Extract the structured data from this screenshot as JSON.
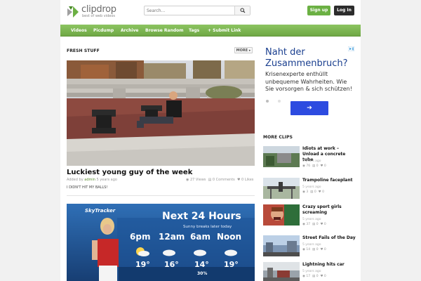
{
  "brand": {
    "name": "clipdrop",
    "tagline": "best of web videos"
  },
  "search": {
    "placeholder": "Search..."
  },
  "auth": {
    "signup": "Sign up",
    "login": "Log In"
  },
  "nav": {
    "items": [
      {
        "label": "Videos"
      },
      {
        "label": "Picdump"
      },
      {
        "label": "Archive"
      },
      {
        "label": "Browse Random"
      },
      {
        "label": "Tags"
      },
      {
        "label": "+ Submit Link"
      }
    ]
  },
  "fresh": {
    "title": "FRESH STUFF",
    "more": "MORE ▸",
    "post": {
      "title": "Luckiest young guy of the week",
      "added_by": "Added by",
      "author": "admin",
      "age": "5 years ago",
      "views": "27 Views",
      "comments": "0 Comments",
      "likes": "0 Likes",
      "excerpt": "I DIDN'T HIT MY BALLS!"
    },
    "weather": {
      "brand": "SkyTracker",
      "headline": "Next 24 Hours",
      "sub": "Sunny breaks later today",
      "times": [
        "6pm",
        "12am",
        "6am",
        "Noon"
      ],
      "temps": [
        "19°",
        "16°",
        "14°",
        "19°"
      ],
      "pop": "30%"
    }
  },
  "ad": {
    "headline": "Naht der Zusammenbruch?",
    "body": "Krisenexperte enthüllt unbequeme Wahrheiten. Wie Sie vorsorgen & sich schützen!",
    "cta": "➔"
  },
  "more_clips": {
    "title": "MORE CLIPS",
    "items": [
      {
        "title": "Idiots at work – Unload a concrete tube",
        "age": "5 years ago",
        "views": "76",
        "comments": "0",
        "likes": "0"
      },
      {
        "title": "Trampoline faceplant",
        "age": "5 years ago",
        "views": "3",
        "comments": "0",
        "likes": "0"
      },
      {
        "title": "Crazy sport girls screaming",
        "age": "5 years ago",
        "views": "37",
        "comments": "0",
        "likes": "0"
      },
      {
        "title": "Street Fails of the Day",
        "age": "5 years ago",
        "views": "14",
        "comments": "0",
        "likes": "0"
      },
      {
        "title": "Lightning hits car",
        "age": "5 years ago",
        "views": "17",
        "comments": "0",
        "likes": "0"
      }
    ]
  },
  "colors": {
    "accent": "#6bb043",
    "nav": "#7ab551",
    "ad_blue": "#2d4be0",
    "login": "#2c2c2c"
  }
}
